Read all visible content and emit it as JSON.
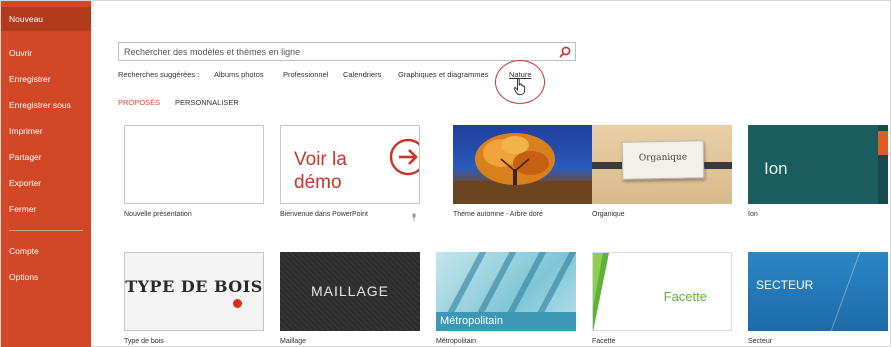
{
  "sidebar": {
    "items": [
      {
        "label": "Nouveau",
        "active": true
      },
      {
        "label": "Ouvrir"
      },
      {
        "label": "Enregistrer"
      },
      {
        "label": "Enregistrer sous"
      },
      {
        "label": "Imprimer"
      },
      {
        "label": "Partager"
      },
      {
        "label": "Exporter"
      },
      {
        "label": "Fermer"
      },
      {
        "label": "Compte"
      },
      {
        "label": "Options"
      }
    ]
  },
  "search": {
    "placeholder": "Rechercher des modèles et thèmes en ligne",
    "value": ""
  },
  "suggested": {
    "label": "Recherches suggérées :",
    "items": [
      "Albums photos",
      "Professionnel",
      "Calendriers",
      "Graphiques et diagrammes",
      "Nature"
    ]
  },
  "tabs": [
    "PROPOSÉS",
    "PERSONNALISER"
  ],
  "templates": [
    {
      "name": "Nouvelle présentation"
    },
    {
      "name": "Bienvenue dans PowerPoint",
      "preview": "Voir la démo"
    },
    {
      "name": "Thème automne - Arbre doré"
    },
    {
      "name": "Organique",
      "preview": "Organique"
    },
    {
      "name": "Ion",
      "preview": "Ion"
    },
    {
      "name": "Type de bois",
      "preview": "TYPE DE BOIS"
    },
    {
      "name": "Maillage",
      "preview": "MAILLAGE"
    },
    {
      "name": "Métropolitain",
      "preview": "Métropolitain"
    },
    {
      "name": "Facette",
      "preview": "Facette"
    },
    {
      "name": "Secteur",
      "preview": "SECTEUR"
    }
  ],
  "colors": {
    "sidebar": "#d24726",
    "sidebar_active": "#b23b1d",
    "accent": "#d24726",
    "highlight": "#c9342b"
  },
  "icons": [
    "search-icon",
    "arrow-right-circle-icon",
    "hand-pointer-icon",
    "pin-icon"
  ]
}
